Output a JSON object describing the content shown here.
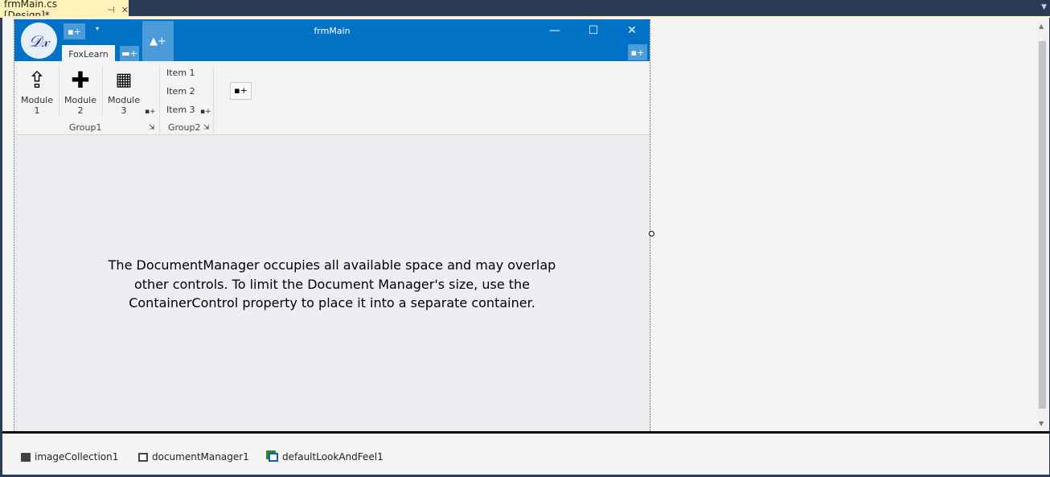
{
  "document_tab": {
    "title": "frmMain.cs [Design]*",
    "pin_icon": "pin-icon",
    "close_icon": "close-icon"
  },
  "form": {
    "title": "frmMain",
    "logo_text": "DX",
    "ribbon_tab": "FoxLearn",
    "groups": [
      {
        "label": "Group1",
        "buttons": [
          {
            "label_line1": "Module",
            "label_line2": "1",
            "icon": "upload-icon"
          },
          {
            "label_line1": "Module",
            "label_line2": "2",
            "icon": "puzzle-icon"
          },
          {
            "label_line1": "Module",
            "label_line2": "3",
            "icon": "grid-icon"
          }
        ]
      },
      {
        "label": "Group2",
        "items": [
          "Item 1",
          "Item 2",
          "Item 3"
        ]
      }
    ],
    "message": "The DocumentManager occupies all available space and may overlap other controls. To limit the Document Manager's size, use the ContainerControl property to place it into a separate container."
  },
  "tray": {
    "components": [
      "imageCollection1",
      "documentManager1",
      "defaultLookAndFeel1"
    ]
  },
  "colors": {
    "titlebar": "#0072c6",
    "tab": "#fef2b9",
    "chrome": "#2b3a55"
  }
}
